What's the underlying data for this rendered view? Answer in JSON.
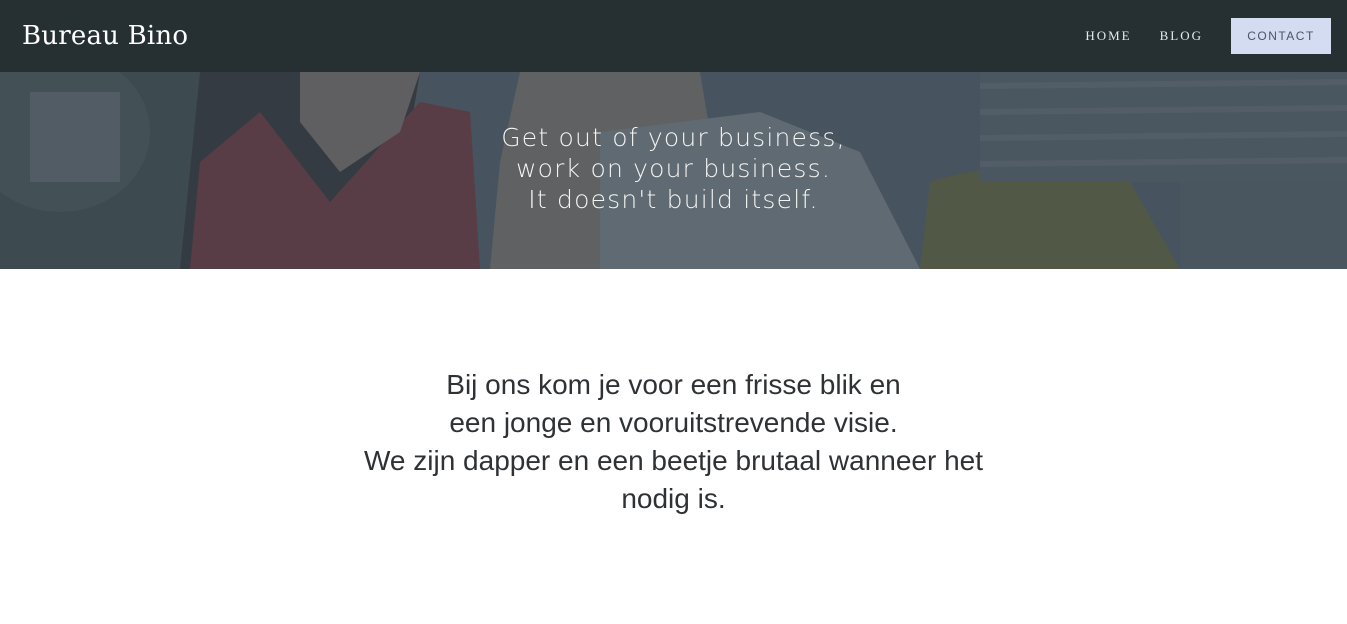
{
  "header": {
    "brand": "Bureau Bino",
    "nav": {
      "home": "HOME",
      "blog": "BLOG",
      "contact": "CONTACT"
    }
  },
  "hero": {
    "lines": [
      "Get out of your business,",
      "work on your business.",
      "It doesn't build itself."
    ]
  },
  "intro": {
    "lines": [
      "Bij ons kom je voor een frisse blik en",
      "een jonge en vooruitstrevende visie.",
      "We zijn dapper en een beetje brutaal wanneer het",
      "nodig is."
    ]
  },
  "colors": {
    "header_bg": "#263033",
    "contact_bg": "#d3dcf0",
    "text_dark": "#2f3235"
  }
}
